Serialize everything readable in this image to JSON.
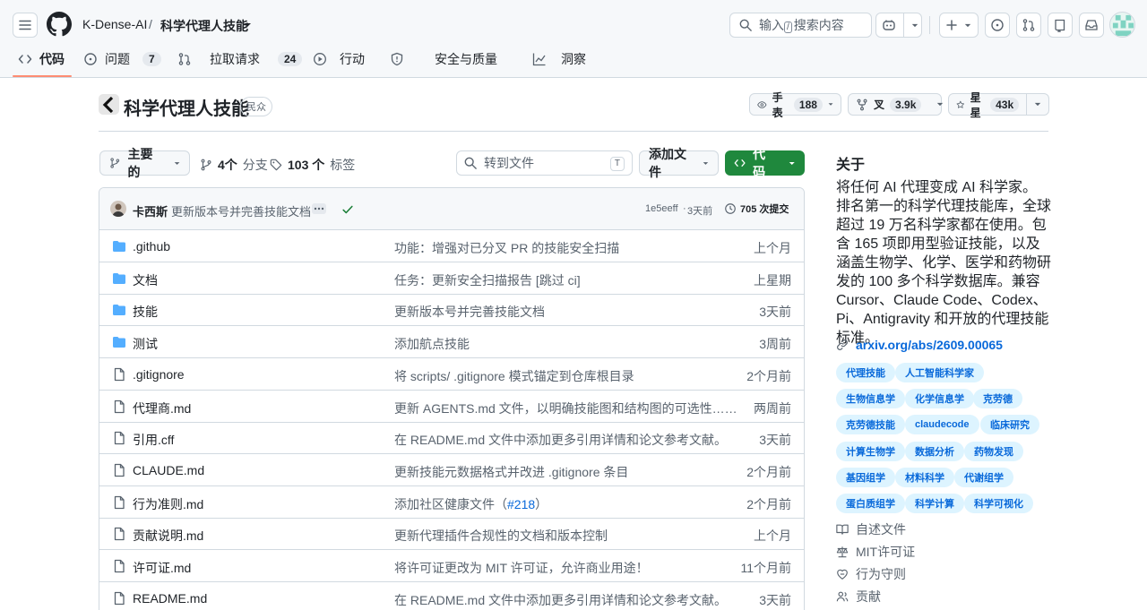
{
  "header": {
    "org": "K-Dense-AI",
    "separator": "/",
    "repo": "科学代理人技能",
    "search_placeholder": "搜索内容",
    "search_prefix": "输入",
    "search_key": "/"
  },
  "tabs": [
    {
      "label": "代码",
      "count": ""
    },
    {
      "label": "问题",
      "count": "7"
    },
    {
      "label": "拉取请求",
      "count": "24"
    },
    {
      "label": "行动",
      "count": ""
    },
    {
      "label": "安全与质量",
      "count": ""
    },
    {
      "label": "洞察",
      "count": ""
    }
  ],
  "repo_header": {
    "title": "科学代理人技能",
    "visibility": "民众",
    "watch_label": "手表",
    "watch_count": "188",
    "fork_label": "叉",
    "fork_count": "3.9k",
    "star_label": "星星",
    "star_count": "43k"
  },
  "toolbar": {
    "branch": "主要的",
    "branches_count": "4个",
    "branches_label": "分支",
    "tags_count": "103 个",
    "tags_label": "标签",
    "goto_placeholder": "转到文件",
    "goto_key": "T",
    "add_file": "添加文件",
    "code": "代码"
  },
  "commit": {
    "author": "卡西斯",
    "message": "更新版本号并完善技能文档",
    "hash": "1e5eeff",
    "dot": "·",
    "age": "3天前",
    "commits": "705 次提交"
  },
  "files": [
    {
      "type": "dir",
      "name": ".github",
      "message": "功能：增强对已分叉 PR 的技能安全扫描",
      "link": "",
      "suffix": "",
      "time": "上个月"
    },
    {
      "type": "dir",
      "name": "文档",
      "message": "任务：更新安全扫描报告 [跳过 ci]",
      "link": "",
      "suffix": "",
      "time": "上星期"
    },
    {
      "type": "dir",
      "name": "技能",
      "message": "更新版本号并完善技能文档",
      "link": "",
      "suffix": "",
      "time": "3天前"
    },
    {
      "type": "dir",
      "name": "测试",
      "message": "添加航点技能",
      "link": "",
      "suffix": "",
      "time": "3周前"
    },
    {
      "type": "file",
      "name": ".gitignore",
      "message": "将 scripts/ .gitignore 模式锚定到仓库根目录",
      "link": "",
      "suffix": "",
      "time": "2个月前"
    },
    {
      "type": "file",
      "name": "代理商.md",
      "message": "更新 AGENTS.md 文件，以明确技能图和结构图的可选性……",
      "link": "",
      "suffix": "",
      "time": "两周前"
    },
    {
      "type": "file",
      "name": "引用.cff",
      "message": "在 README.md 文件中添加更多引用详情和论文参考文献。",
      "link": "",
      "suffix": "",
      "time": "3天前"
    },
    {
      "type": "file",
      "name": "CLAUDE.md",
      "message": "更新技能元数据格式并改进 .gitignore 条目",
      "link": "",
      "suffix": "",
      "time": "2个月前"
    },
    {
      "type": "file",
      "name": "行为准则.md",
      "message": "添加社区健康文件（",
      "link": "#218",
      "suffix": "）",
      "time": "2个月前"
    },
    {
      "type": "file",
      "name": "贡献说明.md",
      "message": "更新代理插件合规性的文档和版本控制",
      "link": "",
      "suffix": "",
      "time": "上个月"
    },
    {
      "type": "file",
      "name": "许可证.md",
      "message": "将许可证更改为 MIT 许可证，允许商业用途！",
      "link": "",
      "suffix": "",
      "time": "11个月前"
    },
    {
      "type": "file",
      "name": "README.md",
      "message": "在 README.md 文件中添加更多引用详情和论文参考文献。",
      "link": "",
      "suffix": "",
      "time": "3天前"
    }
  ],
  "about": {
    "heading": "关于",
    "description": "将任何 AI 代理变成 AI 科学家。排名第一的科学代理技能库，全球超过 19 万名科学家都在使用。包含 165 项即用型验证技能，以及涵盖生物学、化学、医学和药物研发的 100 多个科学数据库。兼容 Cursor、Claude Code、Codex、Pi、Antigravity 和开放的代理技能标准。",
    "link": "arxiv.org/abs/2609.00065",
    "topics": [
      [
        "代理技能",
        "人工智能科学家"
      ],
      [
        "生物信息学",
        "化学信息学",
        "克劳德"
      ],
      [
        "克劳德技能",
        "claudecode",
        "临床研究"
      ],
      [
        "计算生物学",
        "数据分析",
        "药物发现"
      ],
      [
        "基因组学",
        "材料科学",
        "代谢组学"
      ],
      [
        "蛋白质组学",
        "科学计算",
        "科学可视化"
      ]
    ],
    "items": [
      "自述文件",
      "MIT许可证",
      "行为守则",
      "贡献"
    ]
  }
}
